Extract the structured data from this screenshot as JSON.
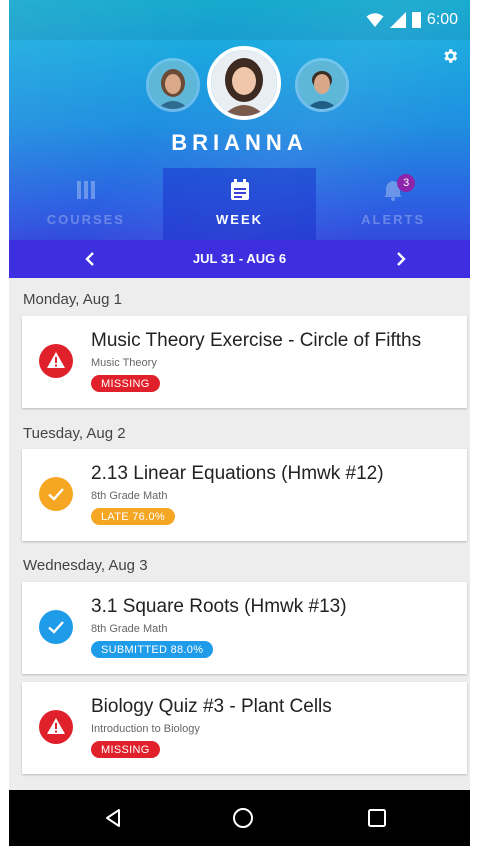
{
  "status_bar": {
    "time": "6:00"
  },
  "profile": {
    "student_name": "BRIANNA"
  },
  "tabs": [
    {
      "label": "COURSES",
      "icon": "courses-icon",
      "active": false
    },
    {
      "label": "WEEK",
      "icon": "calendar-icon",
      "active": true
    },
    {
      "label": "ALERTS",
      "icon": "bell-icon",
      "active": false,
      "badge": "3"
    }
  ],
  "week": {
    "range": "JUL 31 - AUG 6"
  },
  "days": [
    {
      "label": "Monday, Aug 1",
      "items": [
        {
          "title": "Music Theory Exercise - Circle of Fifths",
          "course": "Music Theory",
          "status": "MISSING",
          "kind": "missing"
        }
      ]
    },
    {
      "label": "Tuesday, Aug 2",
      "items": [
        {
          "title": "2.13 Linear Equations (Hmwk #12)",
          "course": "8th Grade Math",
          "status": "LATE  76.0%",
          "kind": "late"
        }
      ]
    },
    {
      "label": "Wednesday, Aug 3",
      "items": [
        {
          "title": "3.1 Square Roots (Hmwk #13)",
          "course": "8th Grade Math",
          "status": "SUBMITTED  88.0%",
          "kind": "submitted"
        },
        {
          "title": "Biology Quiz #3 - Plant Cells",
          "course": "Introduction to Biology",
          "status": "MISSING",
          "kind": "missing"
        }
      ]
    }
  ],
  "colors": {
    "missing": "#e0202a",
    "late": "#f5a623",
    "submitted": "#1e9be9",
    "header_top": "#17b7de",
    "header_bottom": "#3a34d6"
  }
}
